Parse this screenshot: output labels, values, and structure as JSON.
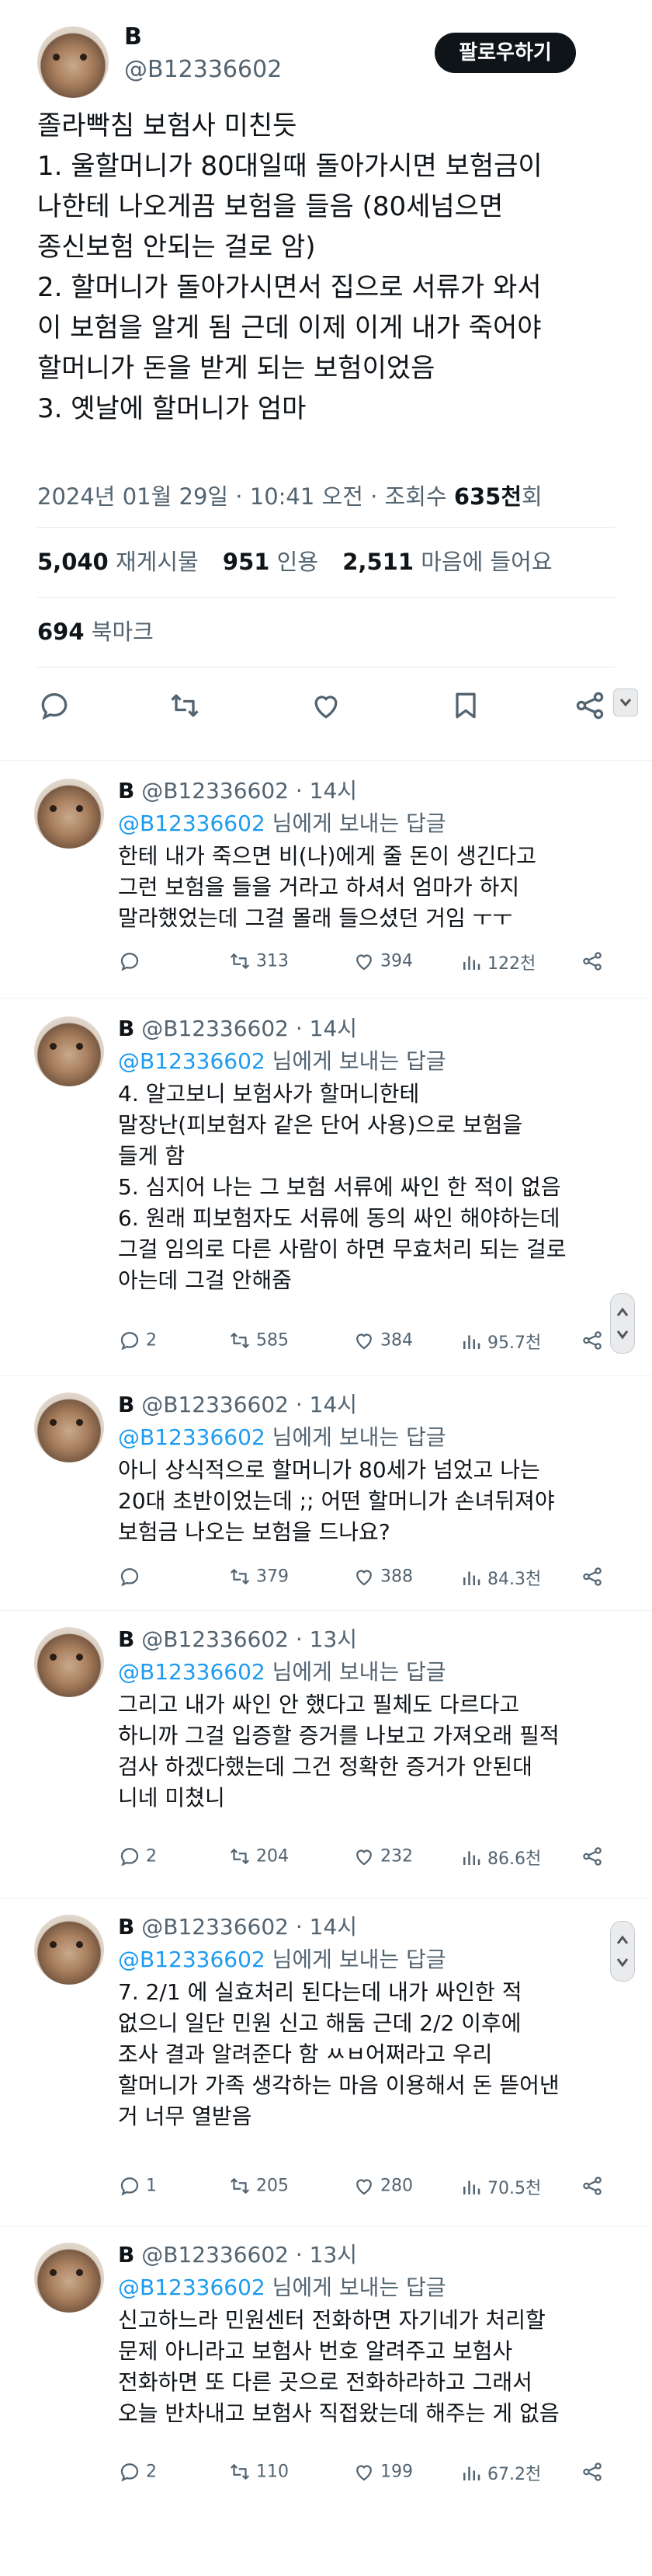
{
  "post": {
    "name": "B",
    "handle": "@B12336602",
    "follow_label": "팔로우하기",
    "lines": [
      "졸라빡침 보험사 미친듯",
      "1. 울할머니가 80대일때 돌아가시면 보험금이",
      "나한테 나오게끔 보험을 들음 (80세넘으면",
      "종신보험 안되는 걸로 암)",
      "2. 할머니가 돌아가시면서 집으로 서류가 와서",
      "이 보험을 알게 됨 근데 이제 이게 내가 죽어야",
      "할머니가 돈을 받게 되는 보험이었음",
      "3. 옛날에 할머니가 엄마"
    ],
    "meta_datetime": "2024년 01월 29일 · 10:41 오전 · 조회수 ",
    "meta_views": "635천",
    "meta_views_suffix": "회",
    "stats": {
      "reposts": "5,040",
      "reposts_label": "재게시물",
      "quotes": "951",
      "quotes_label": "인용",
      "likes": "2,511",
      "likes_label": "마음에 들어요"
    },
    "bookmarks": "694",
    "bookmarks_label": "북마크"
  },
  "replies": [
    {
      "name": "B",
      "handle": "@B12336602 · 14시",
      "mention": "@B12336602",
      "mention_suffix": " 님에게 보내는 답글",
      "lines": [
        "한테 내가 죽으면 비(나)에게 줄 돈이 생긴다고",
        "그런 보험을 들을 거라고 하셔서 엄마가 하지",
        "말라했었는데 그걸 몰래 들으셨던 거임 ㅜㅜ"
      ],
      "replies": "",
      "retweets": "313",
      "likes": "394",
      "views": "122천"
    },
    {
      "name": "B",
      "handle": "@B12336602 · 14시",
      "mention": "@B12336602",
      "mention_suffix": " 님에게 보내는 답글",
      "lines": [
        "4. 알고보니 보험사가 할머니한테",
        "말장난(피보험자 같은 단어 사용)으로 보험을",
        "들게 함",
        "5. 심지어 나는 그 보험 서류에 싸인 한 적이 없음",
        "6. 원래 피보험자도 서류에 동의 싸인 해야하는데",
        "그걸 임의로 다른 사람이 하면 무효처리 되는 걸로",
        "아는데 그걸 안해줌"
      ],
      "replies": "2",
      "retweets": "585",
      "likes": "384",
      "views": "95.7천"
    },
    {
      "name": "B",
      "handle": "@B12336602 · 14시",
      "mention": "@B12336602",
      "mention_suffix": " 님에게 보내는 답글",
      "lines": [
        "아니 상식적으로 할머니가 80세가 넘었고 나는",
        "20대 초반이었는데 ;; 어떤 할머니가 손녀뒤져야",
        "보험금 나오는 보험을 드나요?"
      ],
      "replies": "",
      "retweets": "379",
      "likes": "388",
      "views": "84.3천"
    },
    {
      "name": "B",
      "handle": "@B12336602 · 13시",
      "mention": "@B12336602",
      "mention_suffix": " 님에게 보내는 답글",
      "lines": [
        "그리고 내가 싸인 안 했다고 필체도 다르다고",
        "하니까 그걸 입증할 증거를 나보고 가져오래 필적",
        "검사 하겠다했는데 그건 정확한 증거가 안된대",
        "니네 미쳤니"
      ],
      "replies": "2",
      "retweets": "204",
      "likes": "232",
      "views": "86.6천"
    },
    {
      "name": "B",
      "handle": "@B12336602 · 14시",
      "mention": "@B12336602",
      "mention_suffix": " 님에게 보내는 답글",
      "lines": [
        "7. 2/1 에 실효처리 된다는데 내가 싸인한 적",
        "없으니 일단 민원 신고 해둠 근데 2/2 이후에",
        "조사 결과 알려준다 함 ㅆㅂ어쩌라고 우리",
        "할머니가 가족 생각하는 마음 이용해서 돈 뜯어낸",
        "거 너무 열받음"
      ],
      "replies": "1",
      "retweets": "205",
      "likes": "280",
      "views": "70.5천"
    },
    {
      "name": "B",
      "handle": "@B12336602 · 13시",
      "mention": "@B12336602",
      "mention_suffix": " 님에게 보내는 답글",
      "lines": [
        "신고하느라 민원센터 전화하면 자기네가 처리할",
        "문제 아니라고 보험사 번호 알려주고 보험사",
        "전화하면 또 다른 곳으로 전화하라하고 그래서",
        "오늘 반차내고 보험사 직접왔는데 해주는 게 없음"
      ],
      "replies": "2",
      "retweets": "110",
      "likes": "199",
      "views": "67.2천"
    }
  ]
}
